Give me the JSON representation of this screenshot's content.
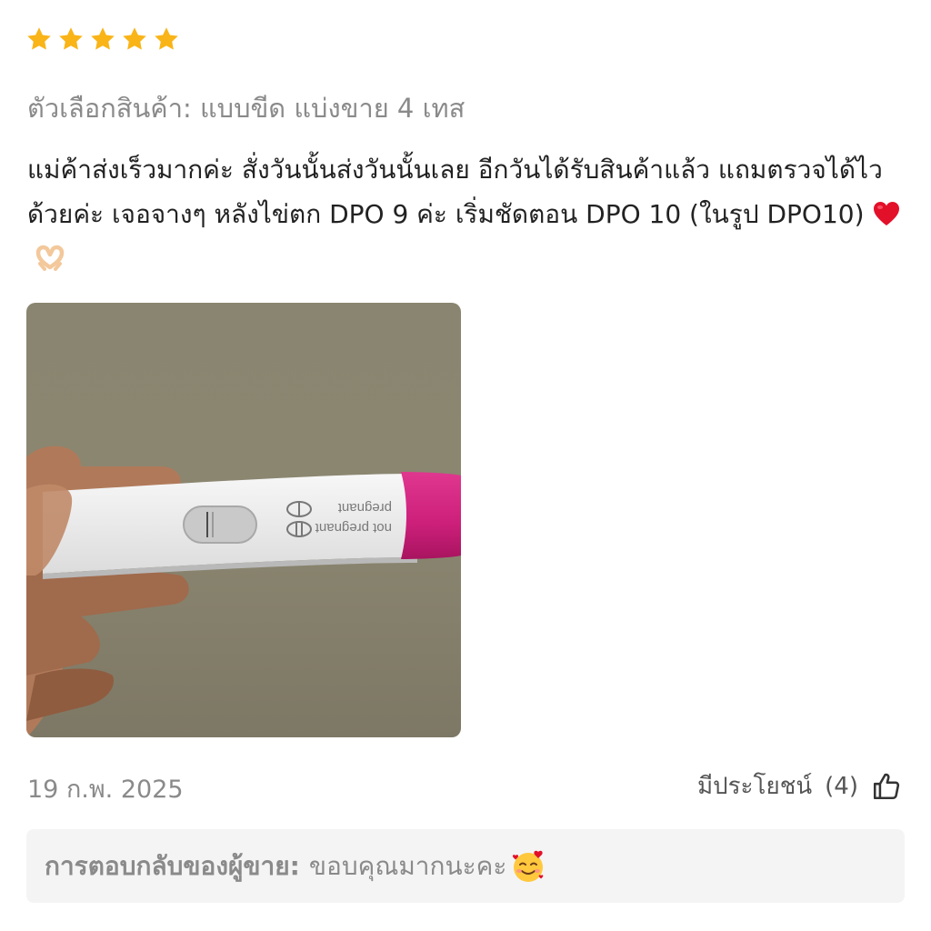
{
  "rating": {
    "value": 5,
    "max": 5,
    "star_color": "#f9b417"
  },
  "variant": {
    "text": "ตัวเลือกสินค้า: แบบขีด แบ่งขาย 4 เทส"
  },
  "review": {
    "text": "แม่ค้าส่งเร็วมากค่ะ สั่งวันนั้นส่งวันนั้นเลย อีกวันได้รับสินค้าแล้ว แถมตรวจได้ไวด้วยค่ะ เจอจางๆ หลังไข่ตก DPO 9 ค่ะ เริ่มชัดตอน DPO 10 (ในรูป DPO10)",
    "emojis": [
      "red-heart-emoji",
      "heart-hands-emoji"
    ]
  },
  "photo": {
    "description_icon": "pregnancy-test-photo",
    "test_label_negative": "not pregnant",
    "test_label_positive": "pregnant"
  },
  "meta": {
    "date": "19 ก.พ. 2025",
    "helpful_label": "มีประโยชน์",
    "helpful_count": "(4)",
    "helpful_icon": "thumbs-up-icon"
  },
  "seller_reply": {
    "label": "การตอบกลับของผู้ขาย:",
    "text": "ขอบคุณมากนะคะ",
    "emoji": "smiling-face-with-hearts-emoji"
  }
}
